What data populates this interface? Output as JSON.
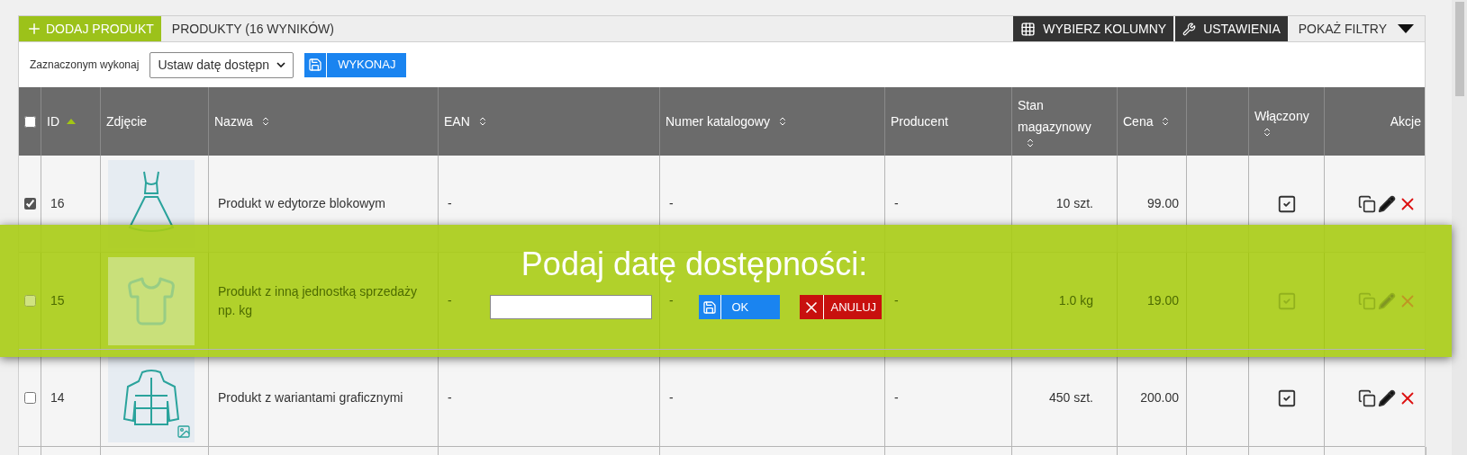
{
  "toolbar": {
    "add_button": "DODAJ PRODUKT",
    "title": "PRODUKTY (16 WYNIKÓW)",
    "choose_columns": "WYBIERZ KOLUMNY",
    "settings": "USTAWIENIA",
    "show_filters": "POKAŻ FILTRY"
  },
  "bulk_actions": {
    "label": "Zaznaczonym wykonaj",
    "select_value": "Ustaw datę dostępn",
    "execute": "WYKONAJ"
  },
  "table": {
    "select_all_checked": false,
    "columns": [
      {
        "label": "ID",
        "sortable": true,
        "sorted": true
      },
      {
        "label": "Zdjęcie",
        "sortable": false
      },
      {
        "label": "Nazwa",
        "sortable": true,
        "sorted": false
      },
      {
        "label": "EAN",
        "sortable": true,
        "sorted": false
      },
      {
        "label": "Numer katalogowy",
        "sortable": true,
        "sorted": false
      },
      {
        "label": "Producent",
        "sortable": false
      },
      {
        "label": "Stan magazynowy",
        "sortable": true,
        "sorted": false
      },
      {
        "label": "Cena",
        "sortable": true,
        "sorted": false
      },
      {
        "sortable": false
      },
      {
        "label": "Włączony",
        "sortable": true,
        "sorted": false
      },
      {
        "label": "Akcje",
        "sortable": false
      }
    ],
    "rows": [
      {
        "checked": true,
        "id": "16",
        "kind": "dress",
        "name": "Produkt w edytorze blokowym",
        "ean": "-",
        "catalog_number": "-",
        "producer": "-",
        "stock": "10 szt.",
        "price": "99.00",
        "enabled": true
      },
      {
        "checked": false,
        "id": "15",
        "kind": "tshirt",
        "name": "Produkt z inną jednostką sprzedaży np. kg",
        "ean": "-",
        "catalog_number": "-",
        "producer": "-",
        "stock": "1.0 kg",
        "price": "19.00",
        "enabled": true
      },
      {
        "checked": false,
        "id": "14",
        "kind": "jacket",
        "name": "Produkt z wariantami graficznymi",
        "ean": "-",
        "catalog_number": "-",
        "producer": "-",
        "stock": "450 szt.",
        "price": "200.00",
        "enabled": true
      }
    ]
  },
  "dialog": {
    "title": "Podaj datę dostępności:",
    "ok": "OK",
    "cancel": "ANULUJ"
  }
}
